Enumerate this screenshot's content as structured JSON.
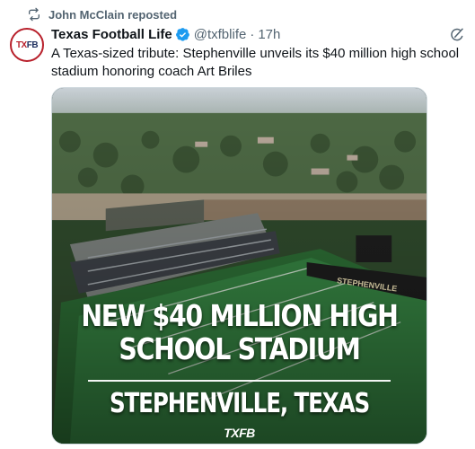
{
  "repost": {
    "label": "John McClain reposted",
    "icon": "repost-icon"
  },
  "author": {
    "avatar_text_left": "TX",
    "avatar_text_right": "FB",
    "name": "Texas Football Life",
    "handle": "@txfblife",
    "separator": "·",
    "time": "17h",
    "verified_color": "#1d9bf0"
  },
  "tweet": {
    "text": "A Texas-sized tribute: Stephenville unveils its $40 million high school stadium honoring coach Art Briles"
  },
  "media": {
    "headline_line1": "NEW $40 MILLION HIGH",
    "headline_line2": "SCHOOL STADIUM",
    "subline": "STEPHENVILLE, TEXAS",
    "logo": "TXFB",
    "field_banner": "STEPHENVILLE"
  },
  "colors": {
    "muted": "#536471",
    "text": "#0f1419",
    "brand_red": "#b8202b"
  }
}
